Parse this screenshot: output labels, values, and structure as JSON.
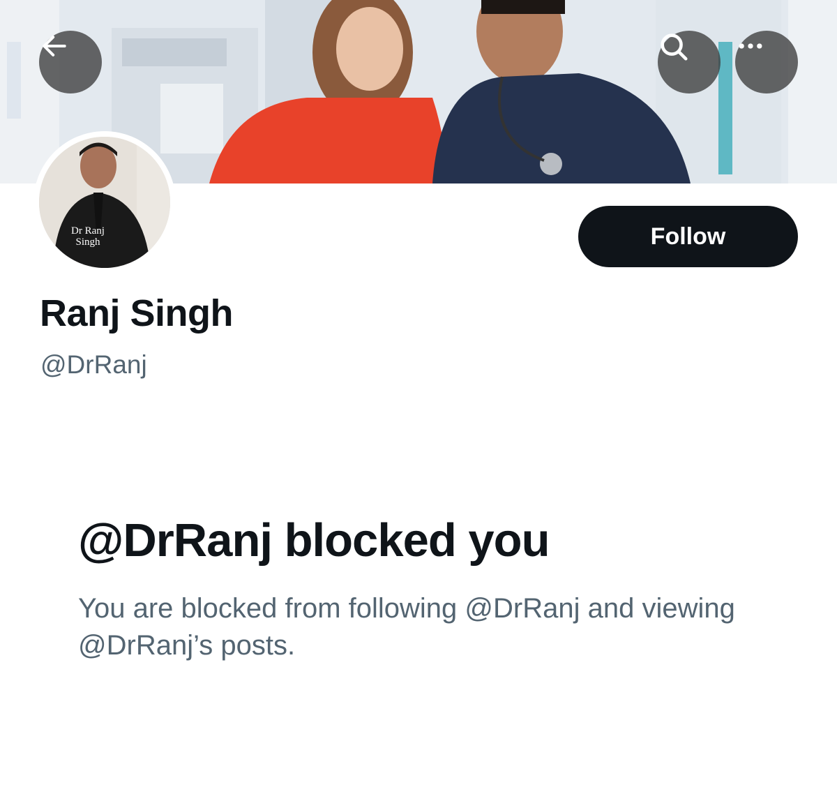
{
  "header": {
    "back_icon": "arrow-left-icon",
    "search_icon": "search-icon",
    "more_icon": "more-horizontal-icon"
  },
  "avatar": {
    "book_title_line1": "Dr Ranj",
    "book_title_line2": "Singh"
  },
  "profile": {
    "display_name": "Ranj Singh",
    "handle": "@DrRanj",
    "follow_label": "Follow"
  },
  "blocked": {
    "title": "@DrRanj blocked you",
    "description": "You are blocked from following @DrRanj and viewing @DrRanj’s posts."
  },
  "colors": {
    "primary_text": "#0f1419",
    "secondary_text": "#536471",
    "button_bg": "#0f1419",
    "button_text": "#ffffff"
  }
}
